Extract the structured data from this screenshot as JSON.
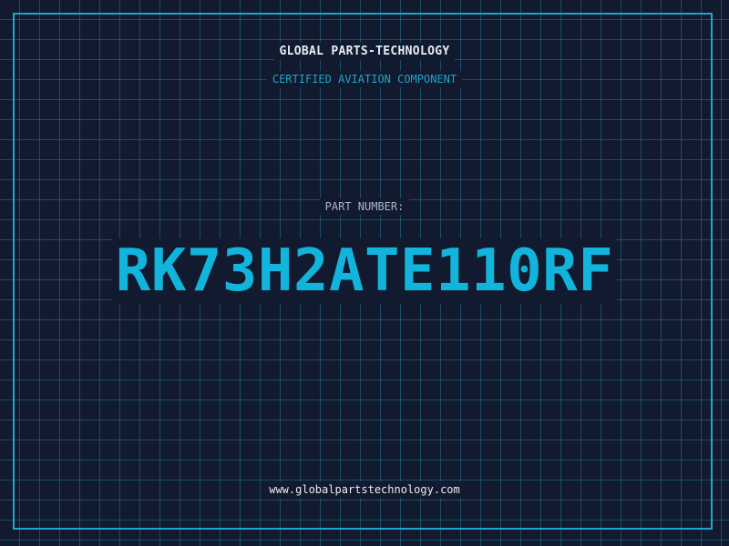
{
  "header": {
    "brand": "GLOBAL PARTS-TECHNOLOGY",
    "subtitle": "CERTIFIED AVIATION COMPONENT"
  },
  "main": {
    "part_label": "PART NUMBER:",
    "part_number": "RK73H2ATE110RF"
  },
  "footer": {
    "website": "www.globalpartstechnology.com"
  },
  "colors": {
    "background": "#111a2e",
    "grid": "#288caa",
    "accent": "#12b4dc",
    "text": "#e8eef5"
  }
}
